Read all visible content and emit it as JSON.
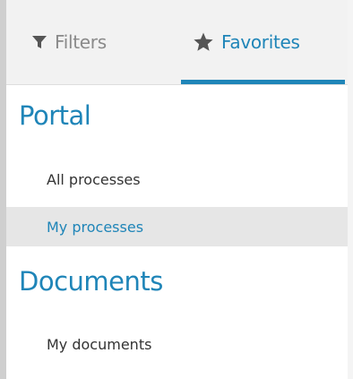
{
  "tabs": [
    {
      "label": "Filters",
      "icon": "filter-icon",
      "active": false
    },
    {
      "label": "Favorites",
      "icon": "star-icon",
      "active": true
    }
  ],
  "sections": [
    {
      "title": "Portal",
      "items": [
        {
          "label": "All processes",
          "selected": false
        },
        {
          "label": "My processes",
          "selected": true
        }
      ]
    },
    {
      "title": "Documents",
      "items": [
        {
          "label": "My documents",
          "selected": false
        }
      ]
    }
  ],
  "colors": {
    "accent": "#1f85b8",
    "muted": "#8a8a8a",
    "selected_bg": "#e6e6e6"
  }
}
